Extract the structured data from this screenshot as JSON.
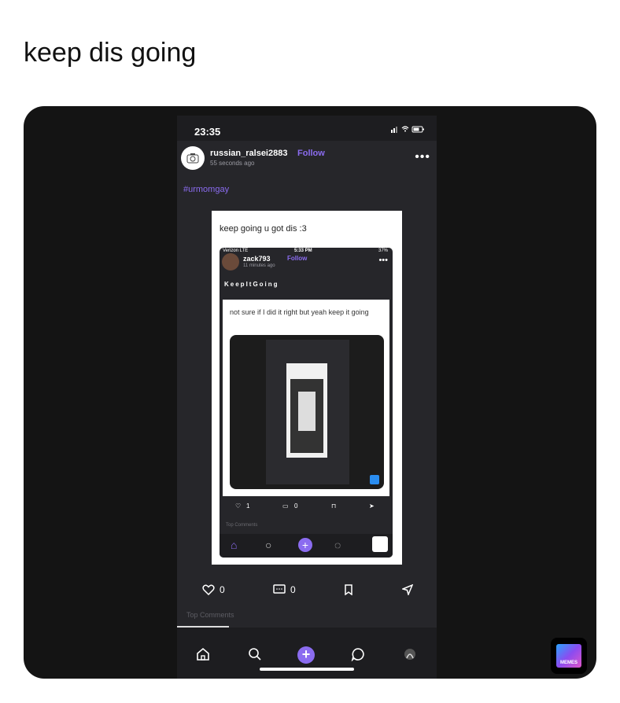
{
  "caption": "keep dis going",
  "status_bar": {
    "time": "23:35",
    "icons": "signal wifi battery"
  },
  "post": {
    "username": "russian_ralsei2883",
    "follow_label": "Follow",
    "time_ago": "55 seconds ago",
    "hashtag": "#urmomgay",
    "image_caption": "keep going u got dis :3"
  },
  "inner_post": {
    "status_carrier": "Verizon  LTE",
    "status_time": "5:33 PM",
    "status_battery": "37%",
    "username": "zack793",
    "follow_label": "Follow",
    "time_ago": "11 minutes ago",
    "title": "KeepItGoing",
    "image_caption": "not sure if I did it right but yeah keep it going",
    "likes": "1",
    "comments": "0",
    "top_comments": "Top Comments"
  },
  "actions": {
    "likes": "0",
    "comments": "0"
  },
  "top_comments_label": "Top Comments",
  "icons": [
    "camera-icon",
    "more-icon",
    "heart-icon",
    "comment-icon",
    "bookmark-icon",
    "share-icon",
    "home-icon",
    "search-icon",
    "plus-icon",
    "chat-icon",
    "profile-icon",
    "memes-logo"
  ],
  "colors": {
    "accent": "#8b6cf0",
    "background": "#141414",
    "phone": "#26262a"
  },
  "watermark": "MEMES"
}
